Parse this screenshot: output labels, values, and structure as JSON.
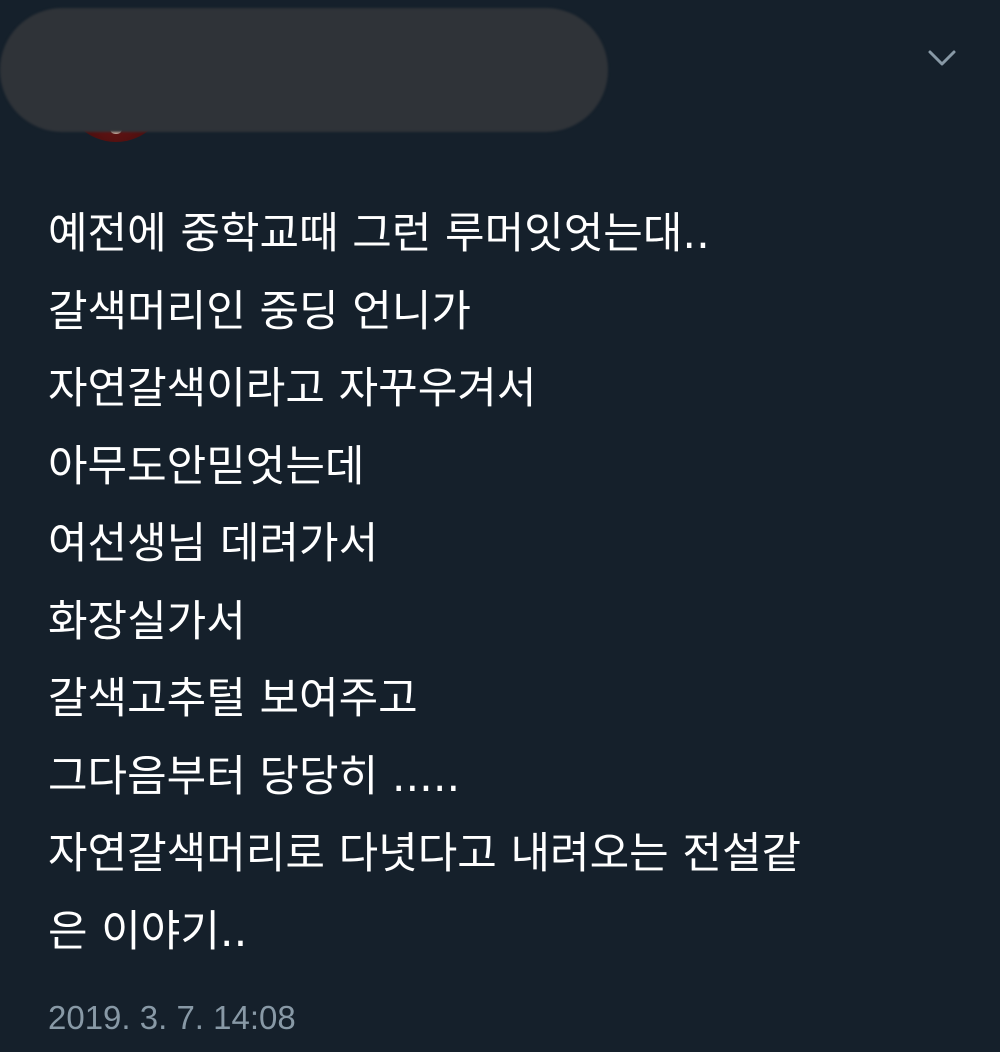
{
  "tweet": {
    "lines": [
      "예전에 중학교때 그런 루머잇엇는대..",
      "갈색머리인 중딩 언니가",
      "자연갈색이라고 자꾸우겨서",
      "아무도안믿엇는데",
      "여선생님 데려가서",
      "화장실가서",
      "갈색고추털 보여주고",
      "그다음부터 당당히 .....",
      "자연갈색머리로 다녓다고 내려오는 전설같",
      "은 이야기.."
    ],
    "timestamp": "2019. 3. 7. 14:08"
  },
  "header": {
    "menu_icon": "chevron-down-icon",
    "avatar_icon": "avatar"
  },
  "colors": {
    "background": "#15202b",
    "text": "#ffffff",
    "secondary_text": "#8899a6",
    "redaction": "#2f3338"
  }
}
